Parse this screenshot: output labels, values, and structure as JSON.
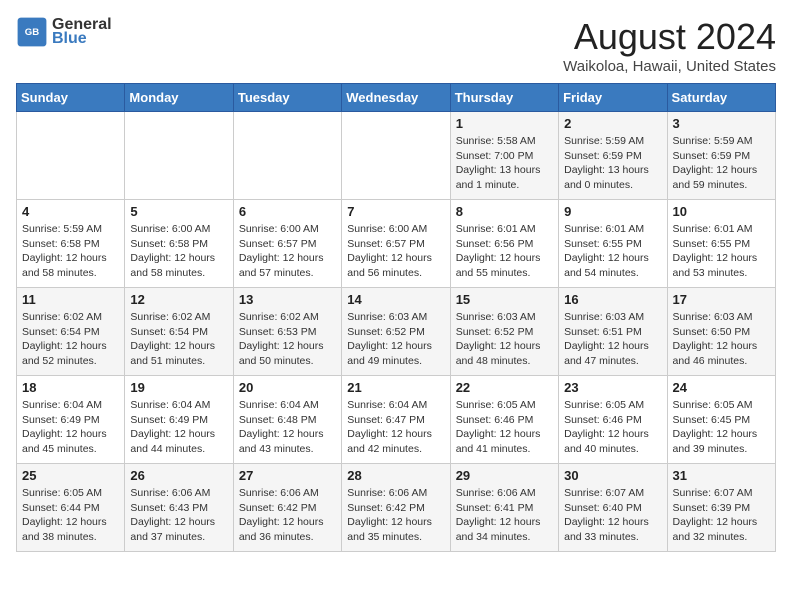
{
  "header": {
    "logo_line1": "General",
    "logo_line2": "Blue",
    "month_year": "August 2024",
    "location": "Waikoloa, Hawaii, United States"
  },
  "days_of_week": [
    "Sunday",
    "Monday",
    "Tuesday",
    "Wednesday",
    "Thursday",
    "Friday",
    "Saturday"
  ],
  "weeks": [
    [
      {
        "day": "",
        "info": ""
      },
      {
        "day": "",
        "info": ""
      },
      {
        "day": "",
        "info": ""
      },
      {
        "day": "",
        "info": ""
      },
      {
        "day": "1",
        "info": "Sunrise: 5:58 AM\nSunset: 7:00 PM\nDaylight: 13 hours\nand 1 minute."
      },
      {
        "day": "2",
        "info": "Sunrise: 5:59 AM\nSunset: 6:59 PM\nDaylight: 13 hours\nand 0 minutes."
      },
      {
        "day": "3",
        "info": "Sunrise: 5:59 AM\nSunset: 6:59 PM\nDaylight: 12 hours\nand 59 minutes."
      }
    ],
    [
      {
        "day": "4",
        "info": "Sunrise: 5:59 AM\nSunset: 6:58 PM\nDaylight: 12 hours\nand 58 minutes."
      },
      {
        "day": "5",
        "info": "Sunrise: 6:00 AM\nSunset: 6:58 PM\nDaylight: 12 hours\nand 58 minutes."
      },
      {
        "day": "6",
        "info": "Sunrise: 6:00 AM\nSunset: 6:57 PM\nDaylight: 12 hours\nand 57 minutes."
      },
      {
        "day": "7",
        "info": "Sunrise: 6:00 AM\nSunset: 6:57 PM\nDaylight: 12 hours\nand 56 minutes."
      },
      {
        "day": "8",
        "info": "Sunrise: 6:01 AM\nSunset: 6:56 PM\nDaylight: 12 hours\nand 55 minutes."
      },
      {
        "day": "9",
        "info": "Sunrise: 6:01 AM\nSunset: 6:55 PM\nDaylight: 12 hours\nand 54 minutes."
      },
      {
        "day": "10",
        "info": "Sunrise: 6:01 AM\nSunset: 6:55 PM\nDaylight: 12 hours\nand 53 minutes."
      }
    ],
    [
      {
        "day": "11",
        "info": "Sunrise: 6:02 AM\nSunset: 6:54 PM\nDaylight: 12 hours\nand 52 minutes."
      },
      {
        "day": "12",
        "info": "Sunrise: 6:02 AM\nSunset: 6:54 PM\nDaylight: 12 hours\nand 51 minutes."
      },
      {
        "day": "13",
        "info": "Sunrise: 6:02 AM\nSunset: 6:53 PM\nDaylight: 12 hours\nand 50 minutes."
      },
      {
        "day": "14",
        "info": "Sunrise: 6:03 AM\nSunset: 6:52 PM\nDaylight: 12 hours\nand 49 minutes."
      },
      {
        "day": "15",
        "info": "Sunrise: 6:03 AM\nSunset: 6:52 PM\nDaylight: 12 hours\nand 48 minutes."
      },
      {
        "day": "16",
        "info": "Sunrise: 6:03 AM\nSunset: 6:51 PM\nDaylight: 12 hours\nand 47 minutes."
      },
      {
        "day": "17",
        "info": "Sunrise: 6:03 AM\nSunset: 6:50 PM\nDaylight: 12 hours\nand 46 minutes."
      }
    ],
    [
      {
        "day": "18",
        "info": "Sunrise: 6:04 AM\nSunset: 6:49 PM\nDaylight: 12 hours\nand 45 minutes."
      },
      {
        "day": "19",
        "info": "Sunrise: 6:04 AM\nSunset: 6:49 PM\nDaylight: 12 hours\nand 44 minutes."
      },
      {
        "day": "20",
        "info": "Sunrise: 6:04 AM\nSunset: 6:48 PM\nDaylight: 12 hours\nand 43 minutes."
      },
      {
        "day": "21",
        "info": "Sunrise: 6:04 AM\nSunset: 6:47 PM\nDaylight: 12 hours\nand 42 minutes."
      },
      {
        "day": "22",
        "info": "Sunrise: 6:05 AM\nSunset: 6:46 PM\nDaylight: 12 hours\nand 41 minutes."
      },
      {
        "day": "23",
        "info": "Sunrise: 6:05 AM\nSunset: 6:46 PM\nDaylight: 12 hours\nand 40 minutes."
      },
      {
        "day": "24",
        "info": "Sunrise: 6:05 AM\nSunset: 6:45 PM\nDaylight: 12 hours\nand 39 minutes."
      }
    ],
    [
      {
        "day": "25",
        "info": "Sunrise: 6:05 AM\nSunset: 6:44 PM\nDaylight: 12 hours\nand 38 minutes."
      },
      {
        "day": "26",
        "info": "Sunrise: 6:06 AM\nSunset: 6:43 PM\nDaylight: 12 hours\nand 37 minutes."
      },
      {
        "day": "27",
        "info": "Sunrise: 6:06 AM\nSunset: 6:42 PM\nDaylight: 12 hours\nand 36 minutes."
      },
      {
        "day": "28",
        "info": "Sunrise: 6:06 AM\nSunset: 6:42 PM\nDaylight: 12 hours\nand 35 minutes."
      },
      {
        "day": "29",
        "info": "Sunrise: 6:06 AM\nSunset: 6:41 PM\nDaylight: 12 hours\nand 34 minutes."
      },
      {
        "day": "30",
        "info": "Sunrise: 6:07 AM\nSunset: 6:40 PM\nDaylight: 12 hours\nand 33 minutes."
      },
      {
        "day": "31",
        "info": "Sunrise: 6:07 AM\nSunset: 6:39 PM\nDaylight: 12 hours\nand 32 minutes."
      }
    ]
  ]
}
